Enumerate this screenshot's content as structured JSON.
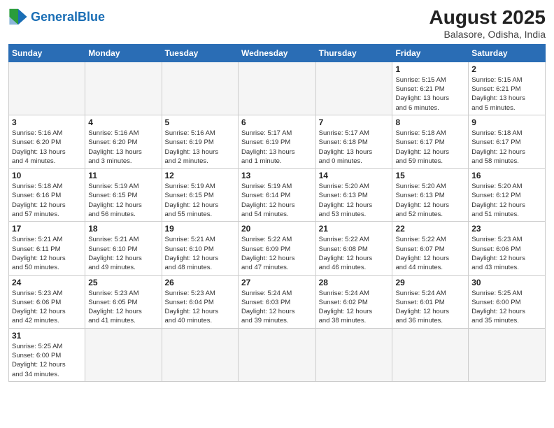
{
  "header": {
    "logo_general": "General",
    "logo_blue": "Blue",
    "month_year": "August 2025",
    "location": "Balasore, Odisha, India"
  },
  "weekdays": [
    "Sunday",
    "Monday",
    "Tuesday",
    "Wednesday",
    "Thursday",
    "Friday",
    "Saturday"
  ],
  "weeks": [
    [
      {
        "day": "",
        "info": ""
      },
      {
        "day": "",
        "info": ""
      },
      {
        "day": "",
        "info": ""
      },
      {
        "day": "",
        "info": ""
      },
      {
        "day": "",
        "info": ""
      },
      {
        "day": "1",
        "info": "Sunrise: 5:15 AM\nSunset: 6:21 PM\nDaylight: 13 hours\nand 6 minutes."
      },
      {
        "day": "2",
        "info": "Sunrise: 5:15 AM\nSunset: 6:21 PM\nDaylight: 13 hours\nand 5 minutes."
      }
    ],
    [
      {
        "day": "3",
        "info": "Sunrise: 5:16 AM\nSunset: 6:20 PM\nDaylight: 13 hours\nand 4 minutes."
      },
      {
        "day": "4",
        "info": "Sunrise: 5:16 AM\nSunset: 6:20 PM\nDaylight: 13 hours\nand 3 minutes."
      },
      {
        "day": "5",
        "info": "Sunrise: 5:16 AM\nSunset: 6:19 PM\nDaylight: 13 hours\nand 2 minutes."
      },
      {
        "day": "6",
        "info": "Sunrise: 5:17 AM\nSunset: 6:19 PM\nDaylight: 13 hours\nand 1 minute."
      },
      {
        "day": "7",
        "info": "Sunrise: 5:17 AM\nSunset: 6:18 PM\nDaylight: 13 hours\nand 0 minutes."
      },
      {
        "day": "8",
        "info": "Sunrise: 5:18 AM\nSunset: 6:17 PM\nDaylight: 12 hours\nand 59 minutes."
      },
      {
        "day": "9",
        "info": "Sunrise: 5:18 AM\nSunset: 6:17 PM\nDaylight: 12 hours\nand 58 minutes."
      }
    ],
    [
      {
        "day": "10",
        "info": "Sunrise: 5:18 AM\nSunset: 6:16 PM\nDaylight: 12 hours\nand 57 minutes."
      },
      {
        "day": "11",
        "info": "Sunrise: 5:19 AM\nSunset: 6:15 PM\nDaylight: 12 hours\nand 56 minutes."
      },
      {
        "day": "12",
        "info": "Sunrise: 5:19 AM\nSunset: 6:15 PM\nDaylight: 12 hours\nand 55 minutes."
      },
      {
        "day": "13",
        "info": "Sunrise: 5:19 AM\nSunset: 6:14 PM\nDaylight: 12 hours\nand 54 minutes."
      },
      {
        "day": "14",
        "info": "Sunrise: 5:20 AM\nSunset: 6:13 PM\nDaylight: 12 hours\nand 53 minutes."
      },
      {
        "day": "15",
        "info": "Sunrise: 5:20 AM\nSunset: 6:13 PM\nDaylight: 12 hours\nand 52 minutes."
      },
      {
        "day": "16",
        "info": "Sunrise: 5:20 AM\nSunset: 6:12 PM\nDaylight: 12 hours\nand 51 minutes."
      }
    ],
    [
      {
        "day": "17",
        "info": "Sunrise: 5:21 AM\nSunset: 6:11 PM\nDaylight: 12 hours\nand 50 minutes."
      },
      {
        "day": "18",
        "info": "Sunrise: 5:21 AM\nSunset: 6:10 PM\nDaylight: 12 hours\nand 49 minutes."
      },
      {
        "day": "19",
        "info": "Sunrise: 5:21 AM\nSunset: 6:10 PM\nDaylight: 12 hours\nand 48 minutes."
      },
      {
        "day": "20",
        "info": "Sunrise: 5:22 AM\nSunset: 6:09 PM\nDaylight: 12 hours\nand 47 minutes."
      },
      {
        "day": "21",
        "info": "Sunrise: 5:22 AM\nSunset: 6:08 PM\nDaylight: 12 hours\nand 46 minutes."
      },
      {
        "day": "22",
        "info": "Sunrise: 5:22 AM\nSunset: 6:07 PM\nDaylight: 12 hours\nand 44 minutes."
      },
      {
        "day": "23",
        "info": "Sunrise: 5:23 AM\nSunset: 6:06 PM\nDaylight: 12 hours\nand 43 minutes."
      }
    ],
    [
      {
        "day": "24",
        "info": "Sunrise: 5:23 AM\nSunset: 6:06 PM\nDaylight: 12 hours\nand 42 minutes."
      },
      {
        "day": "25",
        "info": "Sunrise: 5:23 AM\nSunset: 6:05 PM\nDaylight: 12 hours\nand 41 minutes."
      },
      {
        "day": "26",
        "info": "Sunrise: 5:23 AM\nSunset: 6:04 PM\nDaylight: 12 hours\nand 40 minutes."
      },
      {
        "day": "27",
        "info": "Sunrise: 5:24 AM\nSunset: 6:03 PM\nDaylight: 12 hours\nand 39 minutes."
      },
      {
        "day": "28",
        "info": "Sunrise: 5:24 AM\nSunset: 6:02 PM\nDaylight: 12 hours\nand 38 minutes."
      },
      {
        "day": "29",
        "info": "Sunrise: 5:24 AM\nSunset: 6:01 PM\nDaylight: 12 hours\nand 36 minutes."
      },
      {
        "day": "30",
        "info": "Sunrise: 5:25 AM\nSunset: 6:00 PM\nDaylight: 12 hours\nand 35 minutes."
      }
    ],
    [
      {
        "day": "31",
        "info": "Sunrise: 5:25 AM\nSunset: 6:00 PM\nDaylight: 12 hours\nand 34 minutes."
      },
      {
        "day": "",
        "info": ""
      },
      {
        "day": "",
        "info": ""
      },
      {
        "day": "",
        "info": ""
      },
      {
        "day": "",
        "info": ""
      },
      {
        "day": "",
        "info": ""
      },
      {
        "day": "",
        "info": ""
      }
    ]
  ]
}
